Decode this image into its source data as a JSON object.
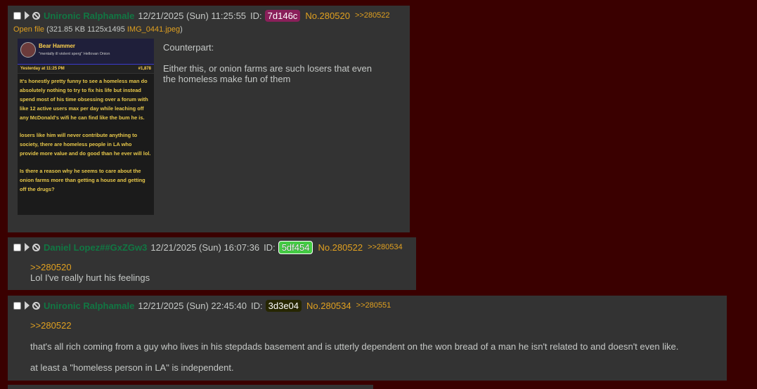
{
  "posts": [
    {
      "name": "Unironic Ralphamale",
      "datetime": "12/21/2025 (Sun) 11:25:55",
      "id_label": "ID:",
      "id": "7d146c",
      "id_color": "#8a1f5a",
      "id_text_color": "#ffffff",
      "number": "No.280520",
      "backlink": ">>280522",
      "file": {
        "link_text": "Open file",
        "info": " (321.85 KB 1125x1495 ",
        "filename": "IMG_0441.jpeg",
        "close": ")"
      },
      "thumbnail": {
        "username": "Bear Hammer",
        "user_title": "\"mentally ill violent sperg\"  Hellovan Onion",
        "post_time": "Yesterday at 11:25 PM",
        "post_num": "#1,878",
        "paragraphs": [
          "It's honestly pretty funny to see a homeless man do absolutely nothing to try to fix his life but instead spend most of his time obsessing over a forum with like 12 active users max per day while leaching off any McDonald's wifi he can find like the bum he is.",
          "losers like him will never contribute anything to society, there are homeless people in LA who provide more value and do good than he ever will lol.",
          "Is there a reason why he seems to care about the onion farms more than getting a house and getting off the drugs?"
        ]
      },
      "lines": [
        "Counterpart:",
        "Either this, or onion farms are such losers that even",
        "the homeless make fun of them"
      ]
    },
    {
      "name": "Daniel Lopez##GxZGw3",
      "datetime": "12/21/2025 (Sun) 16:07:36",
      "id_label": "ID:",
      "id": "5df454",
      "id_color": "#44cc44",
      "id_text_color": "#ffffff",
      "number": "No.280522",
      "backlink": ">>280534",
      "quote": ">>280520",
      "lines": [
        "Lol I've really hurt his feelings"
      ]
    },
    {
      "name": "Unironic Ralphamale",
      "datetime": "12/21/2025 (Sun) 22:45:40",
      "id_label": "ID:",
      "id": "3d3e04",
      "id_color": "#262600",
      "id_text_color": "#ffffff",
      "number": "No.280534",
      "backlink": ">>280551",
      "quote": ">>280522",
      "lines": [
        "that's all rich coming from a guy who lives in his stepdads basement and is utterly dependent on the won bread of a man he isn't related to and doesn't even like.",
        "at least a \"homeless person in LA\" is independent."
      ]
    }
  ]
}
